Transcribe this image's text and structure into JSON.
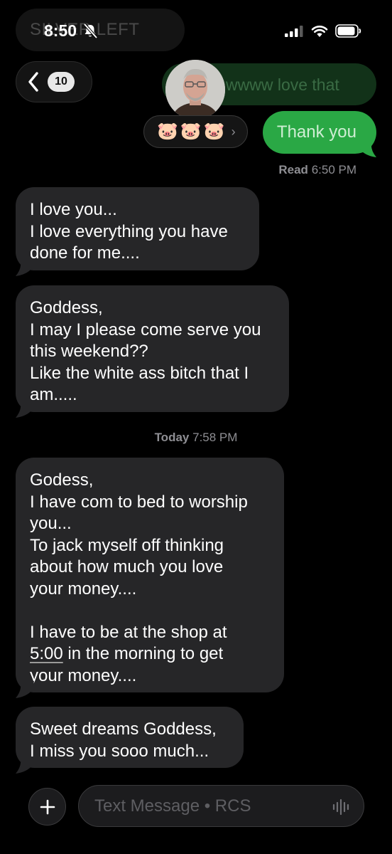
{
  "status_bar": {
    "time": "8:50",
    "ghost_text": "SILVER LEFT"
  },
  "header": {
    "unread_count": "10"
  },
  "thread": {
    "prev_outgoing_text": "wwww love that",
    "reactions": [
      "🐷",
      "🐷",
      "🐷"
    ],
    "reactions_more": "›",
    "outgoing_message": "Thank you",
    "read_label": "Read",
    "read_time": "6:50 PM",
    "timestamp_day": "Today",
    "timestamp_time": "7:58 PM",
    "incoming": [
      {
        "lines": [
          "I love you...",
          "I love everything you have",
          "done for me...."
        ]
      },
      {
        "lines": [
          "Goddess,",
          "I may I please come serve you",
          "this weekend??",
          "Like the white ass bitch that I",
          "am....."
        ]
      },
      {
        "lines": [
          "Godess,",
          "I have com to bed to worship",
          "you...",
          "To jack myself off thinking",
          "about how much you love",
          "your money....",
          "",
          "I have to be at the shop at",
          "5:00",
          " in the morning to get",
          "your money...."
        ]
      },
      {
        "lines": [
          "Sweet dreams Goddess,",
          "I miss you sooo much..."
        ]
      }
    ]
  },
  "composer": {
    "placeholder": "Text Message • RCS"
  },
  "colors": {
    "outgoing_bubble": "#2aa845",
    "incoming_bubble": "#262628",
    "background": "#000000"
  },
  "icons": [
    "bell-slash-icon",
    "signal-icon",
    "wifi-icon",
    "battery-icon",
    "chevron-left-icon",
    "plus-icon",
    "waveform-icon"
  ]
}
